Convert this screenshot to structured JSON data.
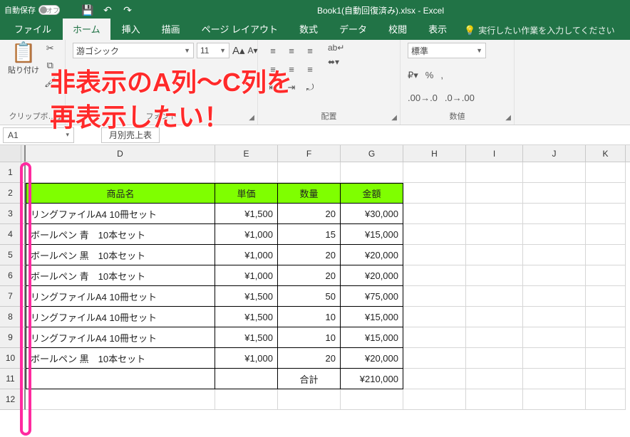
{
  "title_bar": {
    "autosave_label": "自動保存",
    "autosave_state": "オフ",
    "filename": "Book1(自動回復済み).xlsx - Excel"
  },
  "tabs": {
    "file": "ファイル",
    "home": "ホーム",
    "insert": "挿入",
    "draw": "描画",
    "pagelayout": "ページ レイアウト",
    "formulas": "数式",
    "data": "データ",
    "review": "校閲",
    "view": "表示",
    "tell_me": "実行したい作業を入力してください"
  },
  "ribbon": {
    "clipboard": {
      "paste": "貼り付け",
      "label": "クリップボ…"
    },
    "font": {
      "name": "游ゴシック",
      "size": "11",
      "label": "フォント"
    },
    "alignment": {
      "label": "配置"
    },
    "number": {
      "format": "標準",
      "label": "数値"
    }
  },
  "namebox": "A1",
  "sheet_tab_selector": "月別売上表",
  "columns": [
    "D",
    "E",
    "F",
    "G",
    "H",
    "I",
    "J",
    "K"
  ],
  "rows": [
    "1",
    "2",
    "3",
    "4",
    "5",
    "6",
    "7",
    "8",
    "9",
    "10",
    "11",
    "12"
  ],
  "headers": {
    "D": "商品名",
    "E": "単価",
    "F": "数量",
    "G": "金額"
  },
  "data_rows": [
    {
      "D": "リングファイルA4 10冊セット",
      "E": "¥1,500",
      "F": "20",
      "G": "¥30,000"
    },
    {
      "D": "ボールペン 青　10本セット",
      "E": "¥1,000",
      "F": "15",
      "G": "¥15,000"
    },
    {
      "D": "ボールペン 黒　10本セット",
      "E": "¥1,000",
      "F": "20",
      "G": "¥20,000"
    },
    {
      "D": "ボールペン 青　10本セット",
      "E": "¥1,000",
      "F": "20",
      "G": "¥20,000"
    },
    {
      "D": "リングファイルA4 10冊セット",
      "E": "¥1,500",
      "F": "50",
      "G": "¥75,000"
    },
    {
      "D": "リングファイルA4 10冊セット",
      "E": "¥1,500",
      "F": "10",
      "G": "¥15,000"
    },
    {
      "D": "リングファイルA4 10冊セット",
      "E": "¥1,500",
      "F": "10",
      "G": "¥15,000"
    },
    {
      "D": "ボールペン 黒　10本セット",
      "E": "¥1,000",
      "F": "20",
      "G": "¥20,000"
    }
  ],
  "total": {
    "label_F": "合計",
    "value_G": "¥210,000"
  },
  "annotation": {
    "line1": "非表示のA列～C列を",
    "line2": "再表示したい！"
  }
}
